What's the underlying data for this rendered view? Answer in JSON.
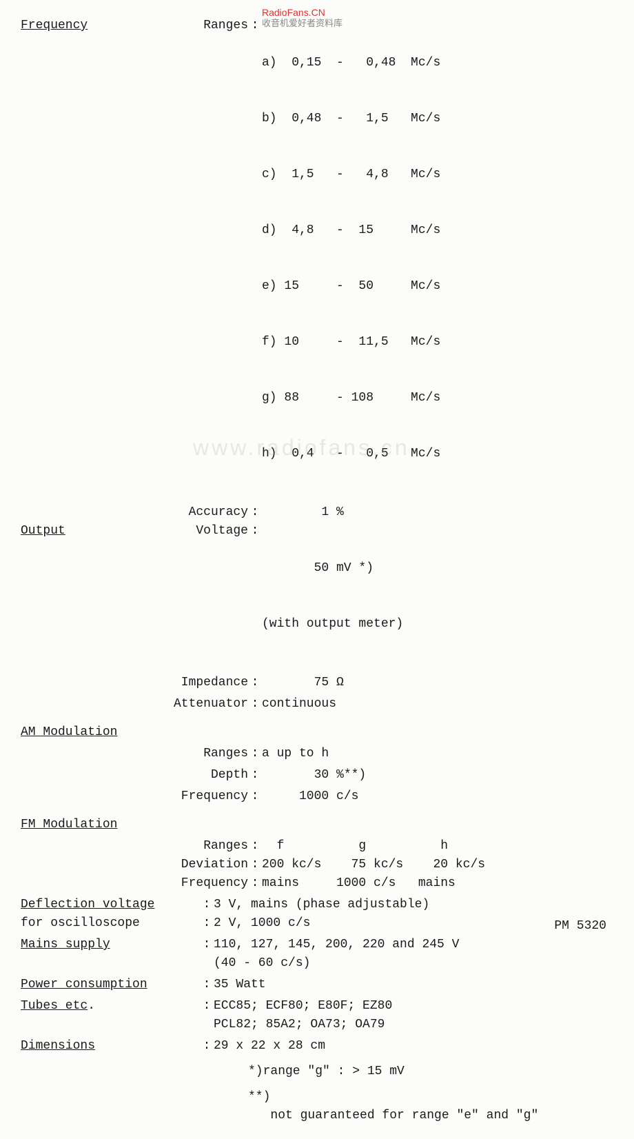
{
  "watermarks": {
    "red": "RadioFans.CN",
    "cn": "收音机爱好者资料库",
    "faint": "www.radiofans.cn"
  },
  "frequency": {
    "heading": "Frequency",
    "ranges_label": "Ranges",
    "ranges": {
      "a": "a)  0,15  -   0,48  Mc/s",
      "b": "b)  0,48  -   1,5   Mc/s",
      "c": "c)  1,5   -   4,8   Mc/s",
      "d": "d)  4,8   -  15     Mc/s",
      "e": "e) 15     -  50     Mc/s",
      "f": "f) 10     -  11,5   Mc/s",
      "g": "g) 88     - 108     Mc/s",
      "h": "h)  0,4   -   0,5   Mc/s"
    },
    "accuracy_label": "Accuracy",
    "accuracy": "        1 %"
  },
  "output": {
    "heading": "Output",
    "voltage_label": "Voltage",
    "voltage": "       50 mV *)",
    "voltage_note": "(with output meter)",
    "impedance_label": "Impedance",
    "impedance": "       75 Ω",
    "attenuator_label": "Attenuator",
    "attenuator": "continuous"
  },
  "am": {
    "heading": "AM Modulation",
    "ranges_label": "Ranges",
    "ranges": "a up to h",
    "depth_label": "Depth",
    "depth": "       30 %**) ",
    "frequency_label": "Frequency",
    "frequency": "     1000 c/s"
  },
  "fm": {
    "heading": "FM Modulation",
    "ranges_label": "Ranges",
    "ranges": "  f          g          h",
    "deviation_label": "Deviation",
    "deviation": "200 kc/s    75 kc/s    20 kc/s",
    "frequency_label": "Frequency",
    "frequency": "mains     1000 c/s   mains"
  },
  "deflection": {
    "heading": "Deflection voltage",
    "line1": "3 V, mains (phase adjustable)",
    "sub_heading": "for oscilloscope",
    "line2": "2 V, 1000 c/s"
  },
  "mains": {
    "heading": "Mains supply",
    "value": "110, 127, 145, 200, 220 and 245 V\n(40 - 60 c/s)"
  },
  "power": {
    "heading": "Power consumption",
    "value": "35 Watt"
  },
  "tubes": {
    "heading": "Tubes etc",
    "value": "ECC85; ECF80; E80F; EZ80\nPCL82; 85A2; OA73; OA79"
  },
  "dimensions": {
    "heading": "Dimensions",
    "value": "29 x 22 x 28 cm"
  },
  "footnotes": {
    "f1": "*)range \"g\" : > 15 mV",
    "f2": "**) \n   not guaranteed for range \"e\" and \"g\""
  },
  "footer": "PM 5320",
  "punct": {
    "colon": ":",
    "dot": "."
  }
}
